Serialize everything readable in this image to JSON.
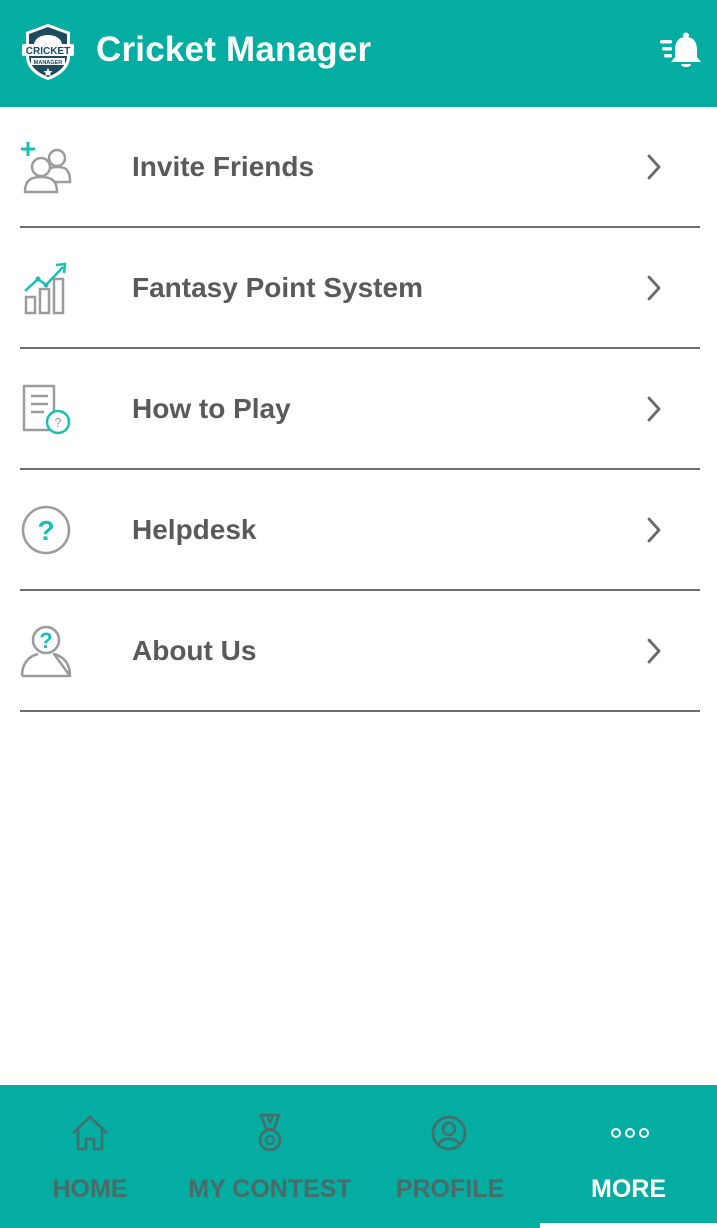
{
  "header": {
    "title": "Cricket Manager",
    "logo_text_top": "CRICKET",
    "logo_text_bottom": "MANAGER",
    "notification_icon": "bell-with-lines-icon"
  },
  "menu": {
    "items": [
      {
        "label": "Invite Friends",
        "icon": "add-users-icon"
      },
      {
        "label": "Fantasy Point System",
        "icon": "growth-chart-icon"
      },
      {
        "label": "How to Play",
        "icon": "document-question-icon"
      },
      {
        "label": "Helpdesk",
        "icon": "question-circle-icon"
      },
      {
        "label": "About Us",
        "icon": "user-question-icon"
      }
    ]
  },
  "bottom_nav": {
    "items": [
      {
        "label": "HOME",
        "icon": "home-icon",
        "active": false
      },
      {
        "label": "MY CONTEST",
        "icon": "medal-icon",
        "active": false
      },
      {
        "label": "PROFILE",
        "icon": "user-circle-icon",
        "active": false
      },
      {
        "label": "MORE",
        "icon": "more-dots-icon",
        "active": true
      }
    ]
  },
  "colors": {
    "brand": "#03ada2",
    "accent": "#1bbfb4",
    "text": "#5a5a5a",
    "nav_inactive": "#4a6b67",
    "nav_active": "#ffffff"
  }
}
